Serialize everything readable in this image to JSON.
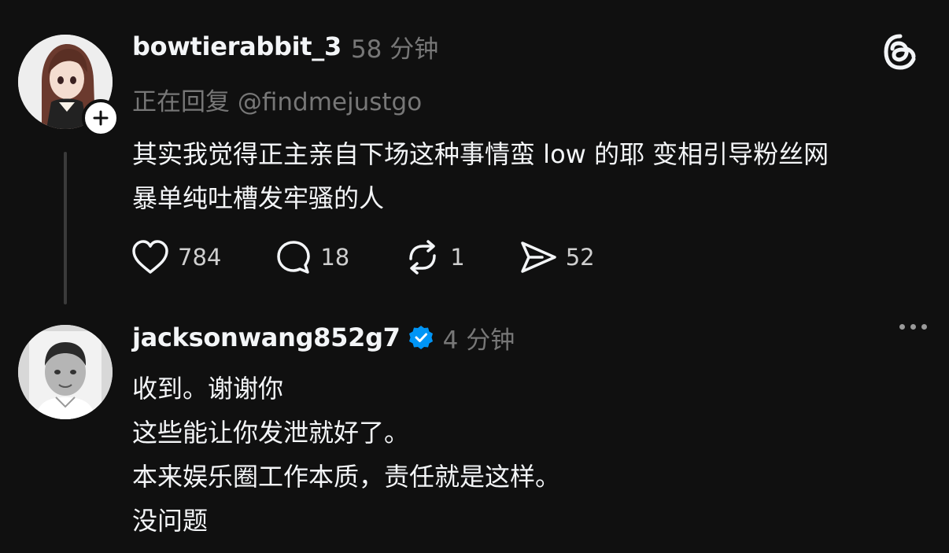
{
  "post1": {
    "username": "bowtierabbit_3",
    "time": "58 分钟",
    "reply_to": "正在回复 @findmejustgo",
    "body_lines": [
      "其实我觉得正主亲自下场这种事情蛮 low 的耶 变相引导粉丝网",
      "暴单纯吐槽发牢骚的人"
    ],
    "actions": {
      "likes": "784",
      "comments": "18",
      "reposts": "1",
      "shares": "52"
    }
  },
  "post2": {
    "username": "jacksonwang852g7",
    "time": "4 分钟",
    "body_lines": [
      "收到。谢谢你",
      "这些能让你发泄就好了。",
      "本来娱乐圈工作本质，责任就是这样。",
      "没问题"
    ]
  },
  "icons": {
    "threads_logo": "threads-logo-icon",
    "follow": "plus-icon",
    "like": "heart-icon",
    "comment": "comment-bubble-icon",
    "repost": "repost-arrows-icon",
    "share": "send-arrow-icon",
    "verified": "verified-badge-icon",
    "more": "more-dots-icon"
  },
  "colors": {
    "background": "#101010",
    "primary_text": "#f3f5f7",
    "secondary_text": "#777777",
    "verified_blue": "#0095f6"
  }
}
